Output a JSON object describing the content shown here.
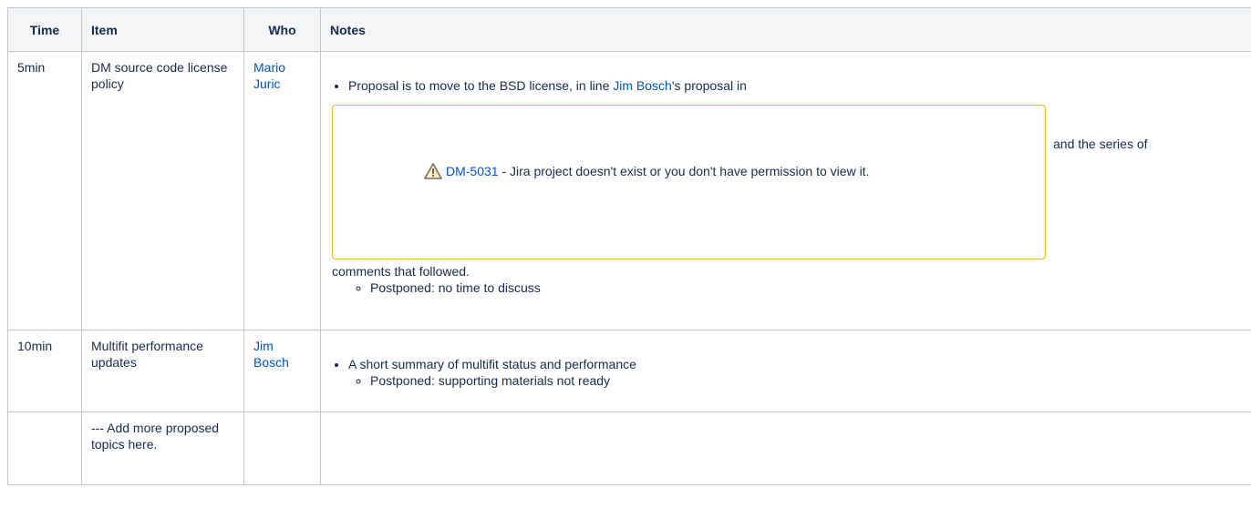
{
  "table": {
    "headers": {
      "time": "Time",
      "item": "Item",
      "who": "Who",
      "notes": "Notes"
    },
    "rows": [
      {
        "time": "5min",
        "item": "DM source code license policy",
        "who": "Mario Juric",
        "note_before_link": "Proposal is to move to the BSD license, in line ",
        "note_link": "Jim Bosch",
        "note_after_link": "'s proposal in",
        "jira_key": "DM-5031",
        "jira_msg": " - Jira project doesn't exist or you don't have permission to view it.",
        "after_box": "and the series of",
        "continuation": "comments that followed.",
        "sub": "Postponed: no time to discuss"
      },
      {
        "time": "10min",
        "item": "Multifit performance updates",
        "who": "Jim Bosch",
        "note": "A short summary of multifit status and performance",
        "sub": "Postponed: supporting materials not ready"
      },
      {
        "time": "",
        "item": "--- Add more proposed topics here.",
        "who": "",
        "note": ""
      }
    ]
  },
  "colors": {
    "link": "#0052cc",
    "border": "#c1c7d0",
    "header_bg": "#f4f5f7",
    "warn": "#f0b429"
  }
}
